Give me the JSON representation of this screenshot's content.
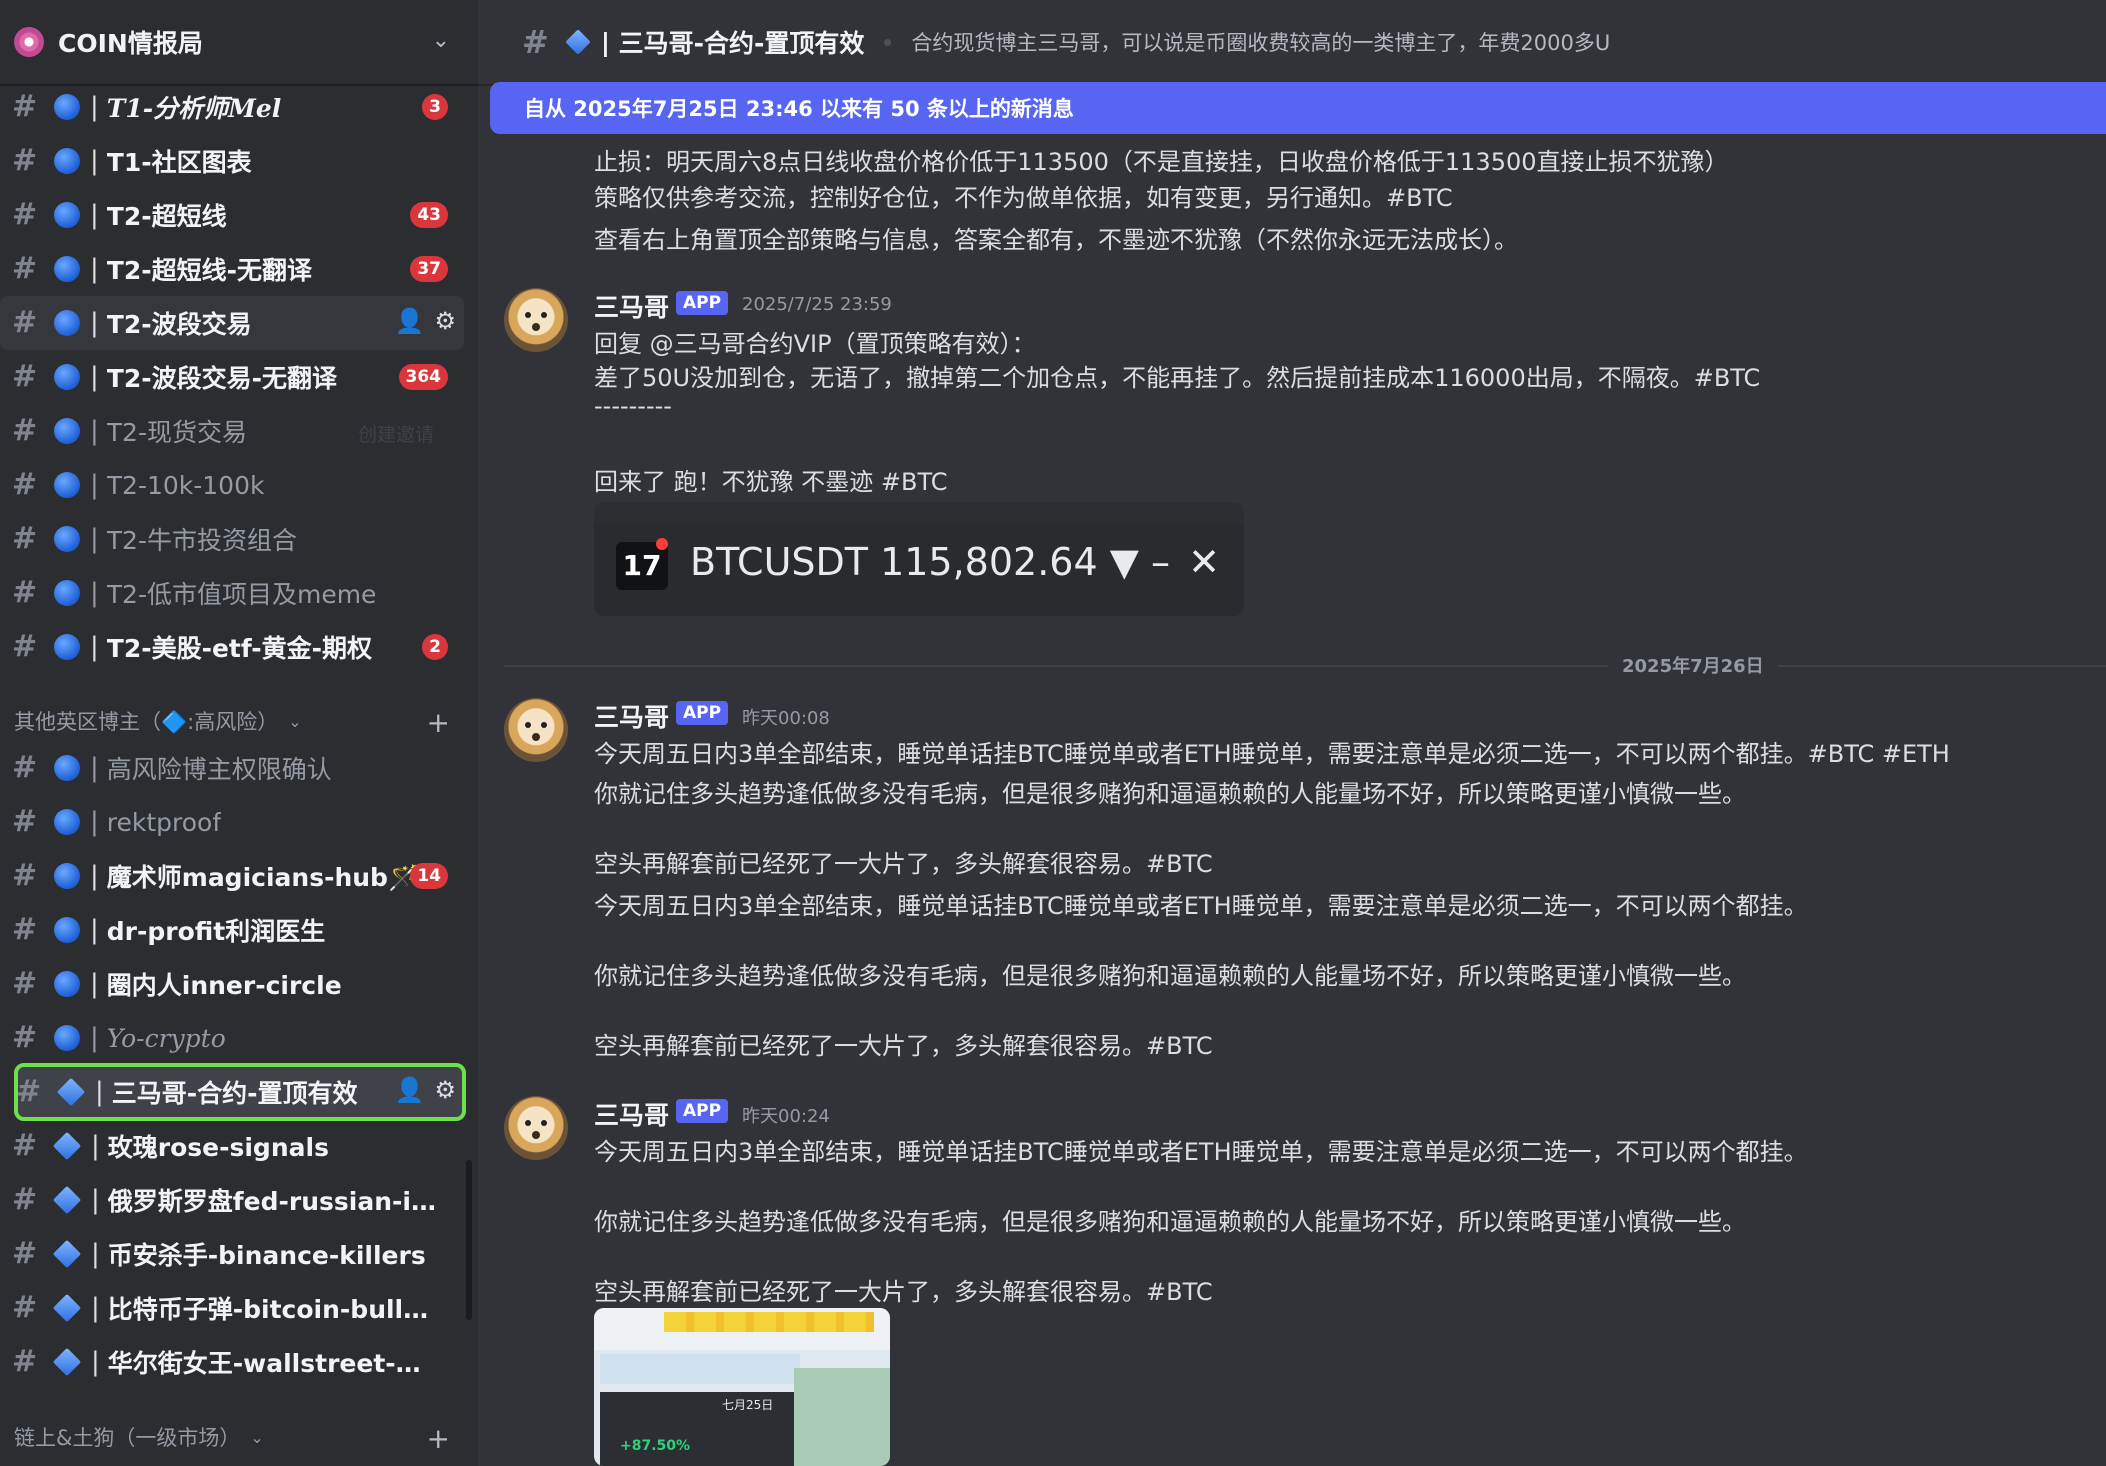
{
  "server": {
    "name": "COIN情报局"
  },
  "sidebar": {
    "channels_a": [
      {
        "name": "T1-分析师Mel",
        "badge": "3"
      },
      {
        "name": "T1-社区图表",
        "badge": ""
      },
      {
        "name": "T2-超短线",
        "badge": "43"
      },
      {
        "name": "T2-超短线-无翻译",
        "badge": "37"
      },
      {
        "name": "T2-波段交易",
        "badge": ""
      },
      {
        "name": "T2-波段交易-无翻译",
        "badge": "364"
      },
      {
        "name": "T2-现货交易",
        "badge": "",
        "extra": "创建邀请"
      },
      {
        "name": "T2-10k-100k",
        "badge": ""
      },
      {
        "name": "T2-牛市投资组合",
        "badge": ""
      },
      {
        "name": "T2-低市值项目及meme",
        "badge": ""
      },
      {
        "name": "T2-美股-etf-黄金-期权",
        "badge": "2"
      }
    ],
    "category_b": "其他英区博主（🔷:高风险）",
    "channels_b": [
      {
        "name": "高风险博主权限确认",
        "badge": ""
      },
      {
        "name": "rektproof",
        "badge": ""
      },
      {
        "name": "魔术师magicians-hub🪄",
        "badge": "14"
      },
      {
        "name": "dr-profit利润医生",
        "badge": ""
      },
      {
        "name": "圈内人inner-circle",
        "badge": ""
      },
      {
        "name": "Yo-crypto",
        "badge": ""
      },
      {
        "name": "三马哥-合约-置顶有效",
        "badge": ""
      },
      {
        "name": "玫瑰rose-signals",
        "badge": ""
      },
      {
        "name": "俄罗斯罗盘fed-russian-insi...",
        "badge": ""
      },
      {
        "name": "币安杀手-binance-killers",
        "badge": ""
      },
      {
        "name": "比特币子弹-bitcoin-bullets",
        "badge": ""
      },
      {
        "name": "华尔街女王-wallstreet-queen",
        "badge": ""
      }
    ],
    "category_c": "链上&土狗（一级市场）"
  },
  "header": {
    "channel_title": "三马哥-合约-置顶有效",
    "topic": "合约现货博主三马哥，可以说是币圈收费较高的一类博主了，年费2000多U"
  },
  "banner": {
    "text": "自从 2025年7月25日 23:46 以来有 50 条以上的新消息"
  },
  "messages": {
    "prev_lines": [
      "止损：明天周六8点日线收盘价格价低于113500（不是直接挂，日收盘价格低于113500直接止损不犹豫）",
      "策略仅供参考交流，控制好仓位，不作为做单依据，如有变更，另行通知。#BTC",
      "查看右上角置顶全部策略与信息，答案全都有，不墨迹不犹豫（不然你永远无法成长）。"
    ],
    "m1": {
      "author": "三马哥",
      "tag": "APP",
      "time": "2025/7/25 23:59",
      "lines": [
        "回复 @三马哥合约VIP（置顶策略有效）：",
        "差了50U没加到仓，无语了，撤掉第二个加仓点，不能再挂了。然后提前挂成本116000出局，不隔夜。#BTC",
        "---------",
        "回来了 跑！不犹豫 不墨迹 #BTC"
      ],
      "embed": {
        "ticker": "BTCUSDT 115,802.64 ▼ –",
        "logo": "17"
      }
    },
    "date_divider": "2025年7月26日",
    "m2": {
      "author": "三马哥",
      "tag": "APP",
      "time": "昨天00:08",
      "lines": [
        "今天周五日内3单全部结束，睡觉单话挂BTC睡觉单或者ETH睡觉单，需要注意单是必须二选一，不可以两个都挂。#BTC #ETH",
        "你就记住多头趋势逢低做多没有毛病，但是很多赌狗和逼逼赖赖的人能量场不好，所以策略更谨小慎微一些。",
        "空头再解套前已经死了一大片了，多头解套很容易。#BTC",
        "今天周五日内3单全部结束，睡觉单话挂BTC睡觉单或者ETH睡觉单，需要注意单是必须二选一，不可以两个都挂。",
        "你就记住多头趋势逢低做多没有毛病，但是很多赌狗和逼逼赖赖的人能量场不好，所以策略更谨小慎微一些。",
        "空头再解套前已经死了一大片了，多头解套很容易。#BTC"
      ]
    },
    "m3": {
      "author": "三马哥",
      "tag": "APP",
      "time": "昨天00:24",
      "lines": [
        "今天周五日内3单全部结束，睡觉单话挂BTC睡觉单或者ETH睡觉单，需要注意单是必须二选一，不可以两个都挂。",
        "你就记住多头趋势逢低做多没有毛病，但是很多赌狗和逼逼赖赖的人能量场不好，所以策略更谨小慎微一些。",
        "空头再解套前已经死了一大片了，多头解套很容易。#BTC"
      ],
      "thumb": {
        "pct": "+87.50%",
        "date": "七月25日"
      }
    }
  },
  "colors": {
    "accent": "#5865f2",
    "badge": "#da373c",
    "selected_outline": "#6ee04a",
    "channel_dot": "#1e5fd6"
  }
}
